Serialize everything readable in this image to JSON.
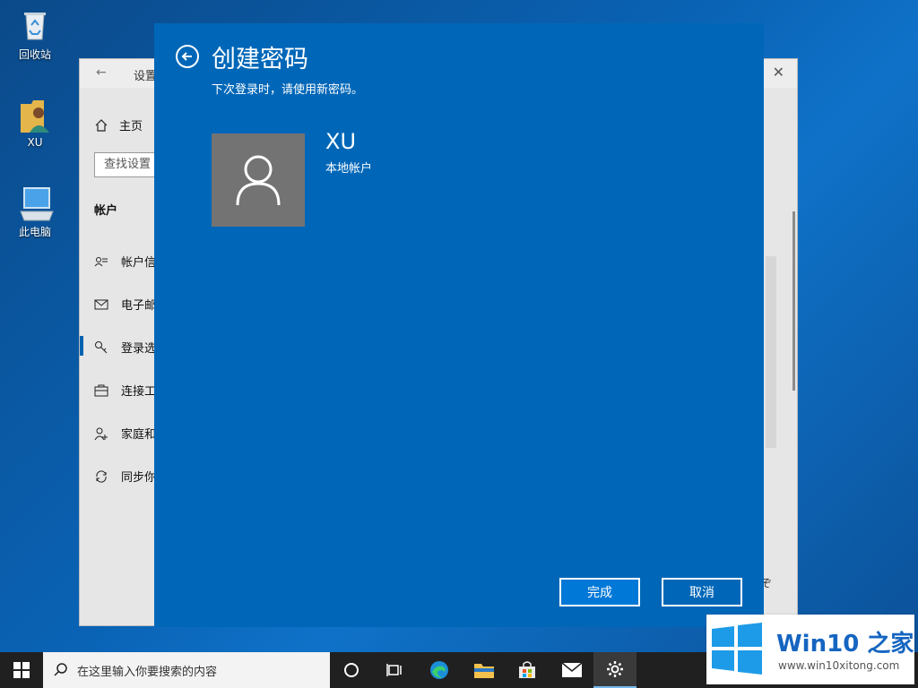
{
  "desktop": {
    "icons": [
      {
        "label": "回收站"
      },
      {
        "label": "XU"
      },
      {
        "label": "此电脑"
      }
    ]
  },
  "settings": {
    "title": "设置",
    "home": "主页",
    "search_placeholder": "查找设置",
    "section": "帐户",
    "nav": [
      {
        "label": "帐户信"
      },
      {
        "label": "电子邮"
      },
      {
        "label": "登录选"
      },
      {
        "label": "连接工"
      },
      {
        "label": "家庭和"
      },
      {
        "label": "同步你"
      }
    ],
    "corner_char": "ぞ"
  },
  "dialog": {
    "title": "创建密码",
    "subtitle": "下次登录时，请使用新密码。",
    "username": "XU",
    "account_type": "本地帐户",
    "finish_label": "完成",
    "cancel_label": "取消",
    "accent_color": "#0067b8"
  },
  "taskbar": {
    "search_placeholder": "在这里输入你要搜索的内容"
  },
  "watermark": {
    "title": "Win10 之家",
    "url": "www.win10xitong.com"
  }
}
